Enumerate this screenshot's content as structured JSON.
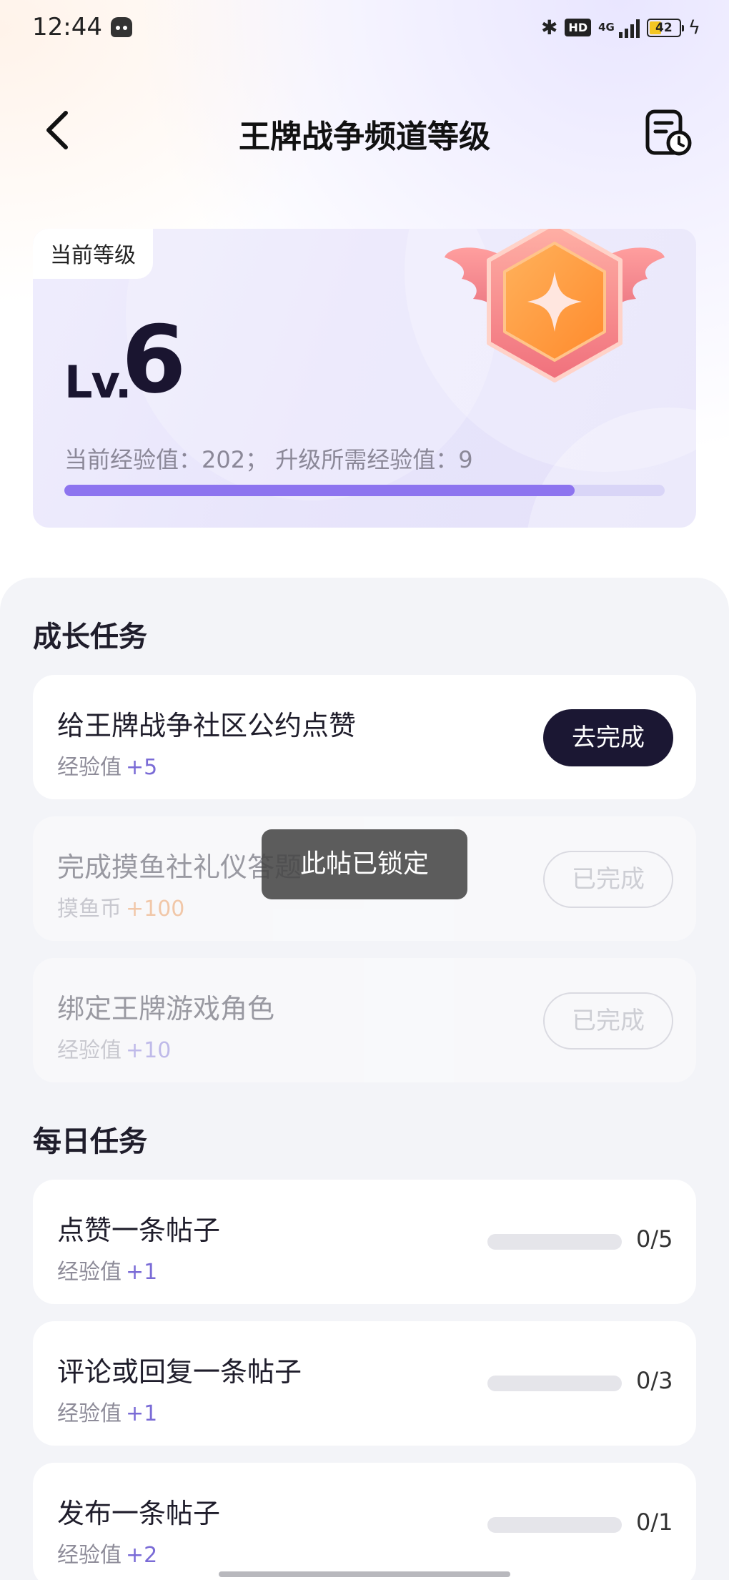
{
  "status_bar": {
    "time": "12:44",
    "hd": "HD",
    "network": "4G",
    "battery": "42",
    "battery_level": 0.42
  },
  "header": {
    "title": "王牌战争频道等级",
    "back_icon": "chevron-left-icon",
    "history_icon": "document-clock-icon"
  },
  "level_card": {
    "tag": "当前等级",
    "prefix": "Lv.",
    "level": "6",
    "exp_text": "当前经验值：202； 升级所需经验值：9",
    "exp_progress": 0.85,
    "badge_icon": "winged-star-badge-icon"
  },
  "growth_tasks": {
    "title": "成长任务",
    "items": [
      {
        "name": "给王牌战争社区公约点赞",
        "reward_label": "经验值",
        "reward_value": "+5",
        "action": "去完成",
        "state": "todo"
      },
      {
        "name": "完成摸鱼社礼仪答题",
        "reward_label": "摸鱼币",
        "reward_value": "+100",
        "action": "已完成",
        "state": "done"
      },
      {
        "name": "绑定王牌游戏角色",
        "reward_label": "经验值",
        "reward_value": "+10",
        "action": "已完成",
        "state": "done"
      }
    ]
  },
  "daily_tasks": {
    "title": "每日任务",
    "items": [
      {
        "name": "点赞一条帖子",
        "reward_label": "经验值",
        "reward_value": "+1",
        "count": "0/5",
        "progress": 0
      },
      {
        "name": "评论或回复一条帖子",
        "reward_label": "经验值",
        "reward_value": "+1",
        "count": "0/3",
        "progress": 0
      },
      {
        "name": "发布一条帖子",
        "reward_label": "经验值",
        "reward_value": "+2",
        "count": "0/1",
        "progress": 0
      }
    ]
  },
  "toast": "此帖已锁定",
  "colors": {
    "accent": "#8d74ef",
    "dark_button": "#1b1733",
    "coin": "#f08a3c",
    "badge_orange": "#ff9a3c",
    "badge_pink": "#f27b86"
  }
}
